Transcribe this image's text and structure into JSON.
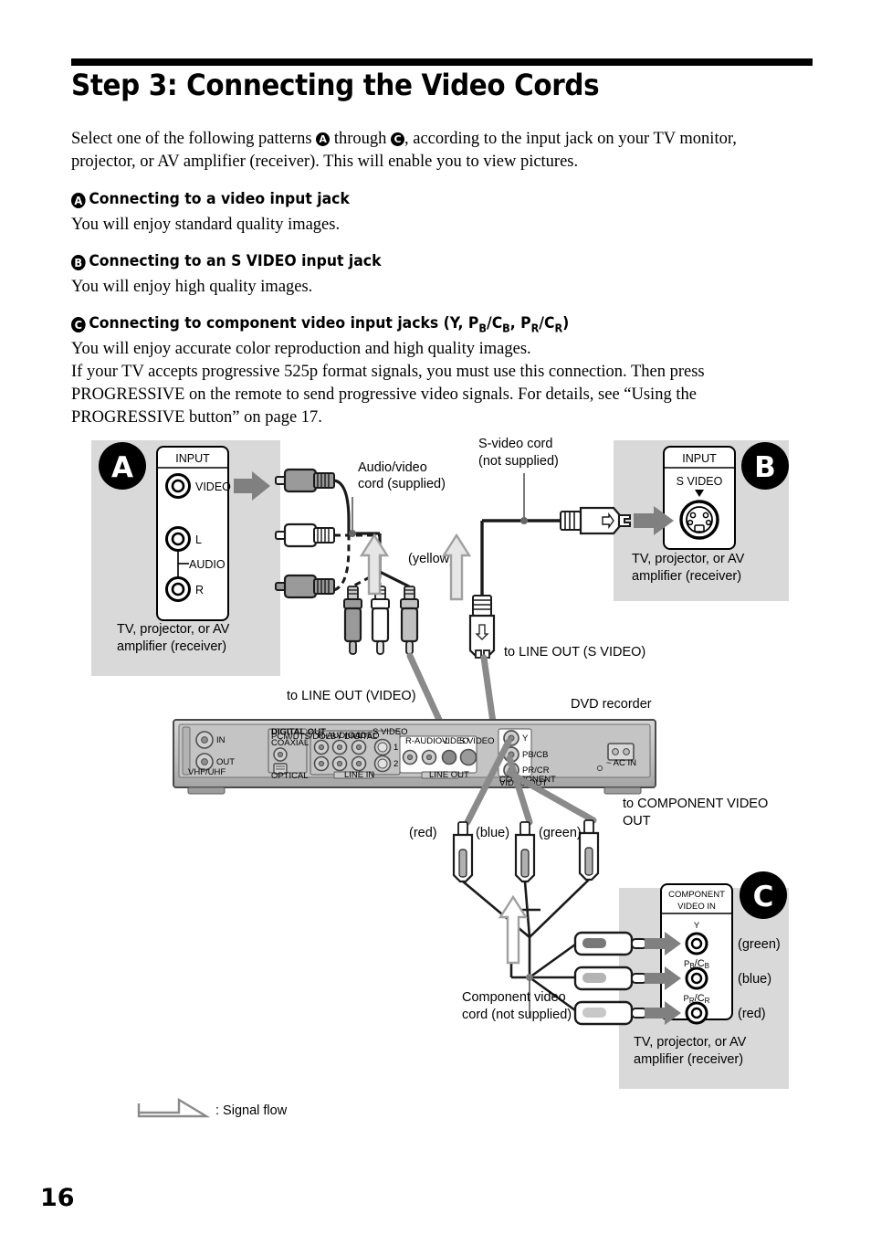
{
  "page": {
    "title": "Step 3: Connecting the Video Cords",
    "number": "16"
  },
  "intro": {
    "line1_a": "Select one of the following patterns ",
    "badge_a": "A",
    "line1_b": " through ",
    "badge_c": "C",
    "line1_c": ", according to the input jack on your TV monitor,",
    "line2": "projector, or AV amplifier (receiver). This will enable you to view pictures."
  },
  "sections": [
    {
      "badge": "A",
      "heading": "Connecting to a video input jack",
      "body": [
        "You will enjoy standard quality images."
      ]
    },
    {
      "badge": "B",
      "heading": "Connecting to an S VIDEO input jack",
      "body": [
        "You will enjoy high quality images."
      ]
    },
    {
      "badge": "C",
      "heading_pre": "Connecting to component video input jacks (Y, P",
      "heading_sub1": "B",
      "heading_mid1": "/C",
      "heading_sub2": "B",
      "heading_mid2": ", P",
      "heading_sub3": "R",
      "heading_mid3": "/C",
      "heading_sub4": "R",
      "heading_end": ")",
      "body": [
        "You will enjoy accurate color reproduction and high quality images.",
        "If your TV accepts progressive 525p format signals, you must use this connection. Then press",
        "PROGRESSIVE on the remote to send progressive video signals. For details, see “Using the",
        "PROGRESSIVE button” on page 17."
      ]
    }
  ],
  "diagram": {
    "panel_a": {
      "badge": "A",
      "input_title": "INPUT",
      "jack_video": "VIDEO",
      "jack_l": "L",
      "jack_audio": "AUDIO",
      "jack_r": "R",
      "caption_line1": "TV, projector, or AV",
      "caption_line2": "amplifier (receiver)"
    },
    "panel_b": {
      "badge": "B",
      "input_title": "INPUT",
      "jack_svideo": "S VIDEO",
      "caption_line1": "TV, projector, or AV",
      "caption_line2": "amplifier (receiver)"
    },
    "panel_c": {
      "badge": "C",
      "input_title_line1": "COMPONENT",
      "input_title_line2": "VIDEO IN",
      "jack_y": "Y",
      "jack_pb_pre": "P",
      "jack_pb_sub1": "B",
      "jack_pb_mid": "/C",
      "jack_pb_sub2": "B",
      "jack_pr_pre": "P",
      "jack_pr_sub1": "R",
      "jack_pr_mid": "/C",
      "jack_pr_sub2": "R",
      "color_green": "(green)",
      "color_blue": "(blue)",
      "color_red": "(red)",
      "caption_line1": "TV, projector, or AV",
      "caption_line2": "amplifier (receiver)"
    },
    "labels": {
      "av_cord_l1": "Audio/video",
      "av_cord_l2": "cord (supplied)",
      "svideo_cord_l1": "S-video cord",
      "svideo_cord_l2": "(not supplied)",
      "yellow": "(yellow)",
      "to_line_out_svideo": "to LINE OUT (S VIDEO)",
      "to_line_out_video": "to LINE OUT (VIDEO)",
      "dvd_recorder": "DVD recorder",
      "to_component_l1": "to COMPONENT VIDEO",
      "to_component_l2": "OUT",
      "plug_red": "(red)",
      "plug_blue": "(blue)",
      "plug_green": "(green)",
      "comp_cord_l1": "Component video",
      "comp_cord_l2": "cord (not supplied)",
      "signal_flow": ": Signal flow"
    },
    "rear_panel": {
      "vhf_uhf": "VHF/UHF",
      "in": "IN",
      "out": "OUT",
      "digital_out": "DIGITAL OUT",
      "digital_out_sub": "PCM/DTS/DOLBY DIGITAL",
      "coaxial": "COAXIAL",
      "optical": "OPTICAL",
      "line_in": "LINE IN",
      "audio_lr": "R-AUDIO-L",
      "video": "VIDEO",
      "svideo": "S VIDEO",
      "ch1": "1",
      "ch2": "2",
      "line_out": "LINE OUT",
      "component_out_l1": "COMPONENT",
      "component_out_l2": "VIDEO OUT",
      "comp_y": "Y",
      "comp_pb": "PB/CB",
      "comp_pr": "PR/CR",
      "ac_in": "~ AC IN"
    },
    "colors": {
      "panel_bg": "#d9d9d9",
      "arrow_gray": "#7f7f7f",
      "plug_gray": "#9a9a9a",
      "plug_light": "#c8c8c8",
      "device_body": "#bfbfbf",
      "device_dark": "#a6a6a6",
      "cord_black": "#1a1a1a"
    }
  }
}
